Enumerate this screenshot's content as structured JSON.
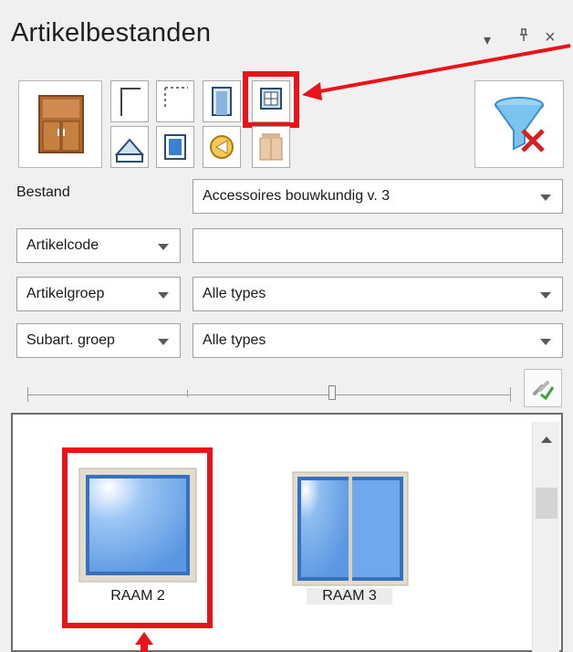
{
  "panel": {
    "title": "Artikelbestanden",
    "dropdown_glyph": "▾",
    "pin_glyph": "ᵖ",
    "close_glyph": "×"
  },
  "toolbar": {
    "icons": [
      "cabinet-icon",
      "wall-corner-icon",
      "dotted-frame-icon",
      "door-icon",
      "window-grid-icon",
      "roof-icon",
      "panel-icon",
      "arrow-circle-icon",
      "multi-cabinet-icon",
      "filter-clear-icon"
    ]
  },
  "form": {
    "bestand_label": "Bestand",
    "bestand_value": "Accessoires bouwkundig v. 3",
    "artikelcode_label": "Artikelcode",
    "artikelcode_value": "",
    "artikelgroep_label": "Artikelgroep",
    "artikelgroep_value": "Alle types",
    "subart_label": "Subart. groep",
    "subart_value": "Alle types"
  },
  "slider": {
    "position": 0.63
  },
  "items": [
    {
      "label": "RAAM 2"
    },
    {
      "label": "RAAM 3"
    }
  ],
  "colors": {
    "highlight": "#e8141a",
    "window_blue": "#6fa8ec",
    "frame": "#d8d2c4"
  }
}
